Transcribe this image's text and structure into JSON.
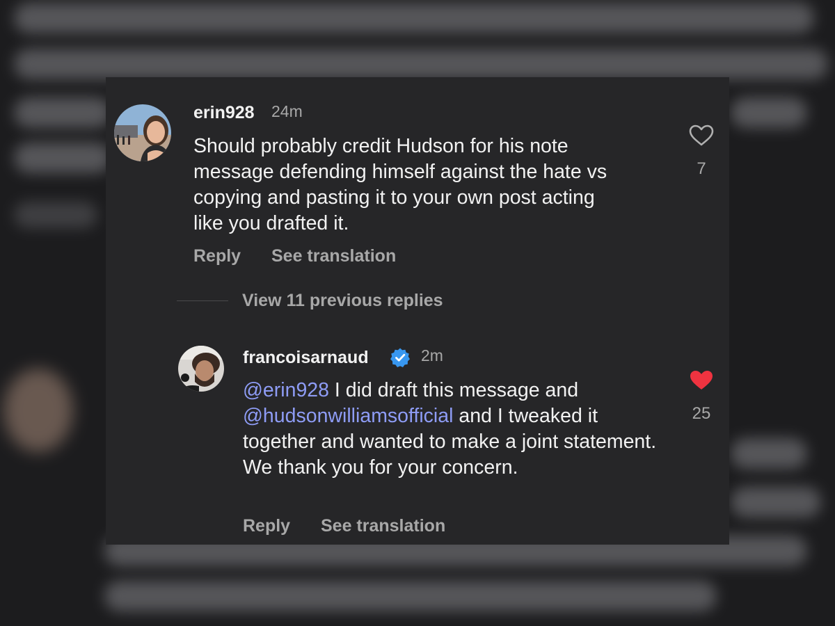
{
  "comments": [
    {
      "username": "erin928",
      "time": "24m",
      "text": "Should probably credit Hudson for his note message defending himself against the hate vs copying and pasting it to your own post acting like you drafted it.",
      "likes": "7",
      "liked": false,
      "reply_label": "Reply",
      "translate_label": "See translation"
    },
    {
      "username": "francoisarnaud",
      "verified": true,
      "time": "2m",
      "mention_1": "@erin928",
      "text_1": " I did draft this message and ",
      "mention_2": "@hudsonwilliamsofficial",
      "text_2": " and I tweaked it together and wanted to make a joint statement. We thank you for your concern.",
      "likes": "25",
      "liked": true,
      "reply_label": "Reply",
      "translate_label": "See translation"
    }
  ],
  "view_replies_label": "View 11 previous replies",
  "colors": {
    "background": "#262628",
    "text": "#f2f2f2",
    "secondary": "#a8a8a8",
    "mention": "#8e9cf5",
    "heart_liked": "#ef3340",
    "verified": "#3897f0"
  },
  "icons": {
    "like": "heart-outline-icon",
    "liked": "heart-filled-icon",
    "verified": "verified-badge-icon"
  }
}
